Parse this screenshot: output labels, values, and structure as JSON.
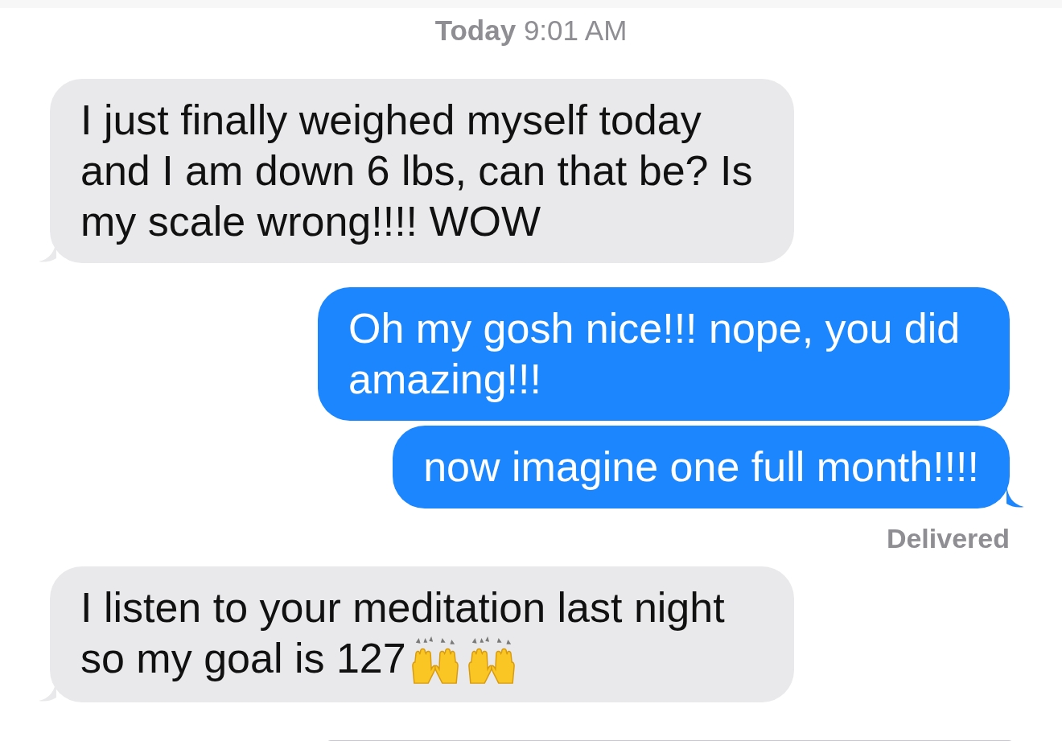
{
  "timestamp": {
    "day": "Today",
    "time": "9:01 AM"
  },
  "messages": [
    {
      "kind": "incoming",
      "text": "I just finally weighed myself today and I am down 6 lbs, can that be? Is my scale wrong!!!!  WOW",
      "tail": true
    },
    {
      "kind": "outgoing",
      "text": "Oh my gosh nice!!! nope, you did amazing!!!",
      "tail": false
    },
    {
      "kind": "outgoing",
      "text": "now imagine one full month!!!!",
      "tail": true,
      "status": "Delivered"
    },
    {
      "kind": "incoming",
      "text": "I listen to your meditation last night so my goal is 127",
      "tail": true,
      "icons": [
        {
          "kind": "raised_hands"
        },
        {
          "kind": "raised_hands"
        }
      ]
    }
  ]
}
